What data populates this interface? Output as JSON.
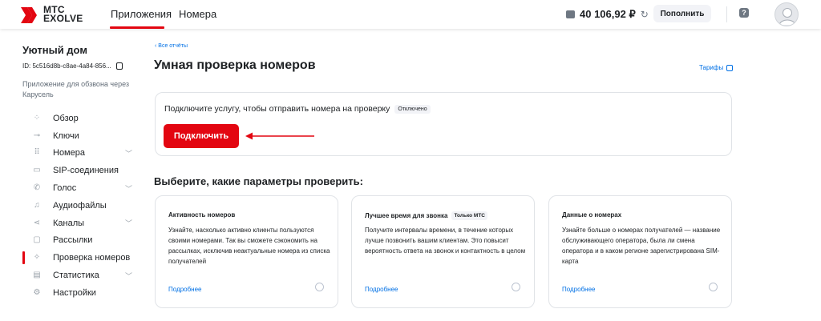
{
  "header": {
    "logo_text_line1": "МТС",
    "logo_text_line2": "EXOLVE",
    "nav": [
      "Приложения",
      "Номера"
    ],
    "balance": "40 106,92 ₽",
    "topup_label": "Пополнить",
    "accent_color": "#e30611"
  },
  "sidebar": {
    "app_title": "Уютный дом",
    "app_id": "ID: 5c516d8b-c8ae-4a84-856...",
    "app_desc": "Приложение для обзвона через Карусель",
    "items": [
      {
        "label": "Обзор",
        "icon": "grid-icon",
        "chevron": false
      },
      {
        "label": "Ключи",
        "icon": "key-icon",
        "chevron": false
      },
      {
        "label": "Номера",
        "icon": "dialpad-icon",
        "chevron": true
      },
      {
        "label": "SIP-соединения",
        "icon": "sip-icon",
        "chevron": false
      },
      {
        "label": "Голос",
        "icon": "phone-icon",
        "chevron": true
      },
      {
        "label": "Аудиофайлы",
        "icon": "music-note-icon",
        "chevron": false
      },
      {
        "label": "Каналы",
        "icon": "channels-icon",
        "chevron": true
      },
      {
        "label": "Рассылки",
        "icon": "chat-icon",
        "chevron": false
      },
      {
        "label": "Проверка номеров",
        "icon": "check-number-icon",
        "chevron": false,
        "active": true
      },
      {
        "label": "Статистика",
        "icon": "chart-icon",
        "chevron": true
      },
      {
        "label": "Настройки",
        "icon": "gear-icon",
        "chevron": false
      }
    ]
  },
  "main": {
    "back_link": "Все отчёты",
    "page_title": "Умная проверка номеров",
    "tariffs_link": "Тарифы",
    "connect": {
      "text": "Подключите услугу, чтобы отправить номера на проверку",
      "status": "Отключено",
      "button": "Подключить"
    },
    "section_title": "Выберите, какие параметры проверить:",
    "options": [
      {
        "title": "Активность номеров",
        "badge": "",
        "desc": "Узнайте, насколько активно клиенты пользуются своими номерами. Так вы сможете сэкономить на рассылках, исключив неактуальные номера из списка получателей",
        "more": "Подробнее"
      },
      {
        "title": "Лучшее время для звонка",
        "badge": "Только МТС",
        "desc": "Получите интервалы времени, в течение которых лучше позвонить вашим клиентам. Это повысит вероятность ответа на звонок и контактность в целом",
        "more": "Подробнее"
      },
      {
        "title": "Данные о номерах",
        "badge": "",
        "desc": "Узнайте больше о номерах получателей — название обслуживающего оператора, была ли смена оператора и в каком регионе зарегистрирована SIM-карта",
        "more": "Подробнее"
      }
    ]
  }
}
